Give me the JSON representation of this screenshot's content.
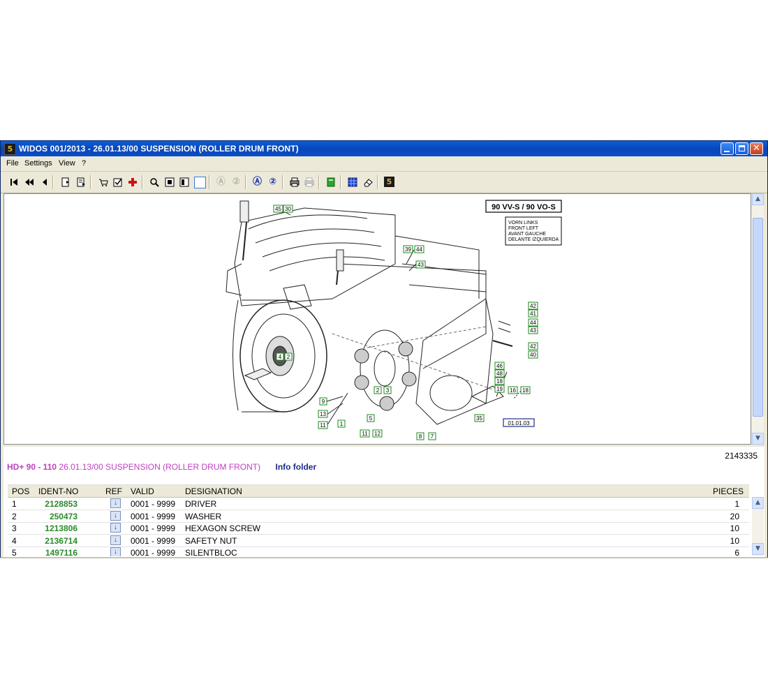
{
  "window": {
    "title": "WIDOS 001/2013 - 26.01.13/00 SUSPENSION (ROLLER DRUM FRONT)",
    "app_icon_glyph": "5"
  },
  "menu": [
    "File",
    "Settings",
    "View",
    "?"
  ],
  "toolbar": [
    {
      "name": "first-page-icon",
      "glyph": "⏮"
    },
    {
      "name": "previous-many-icon",
      "glyph": "⏪"
    },
    {
      "name": "previous-icon",
      "glyph": "◀"
    },
    {
      "name": "document-back-icon",
      "glyph": "🗎"
    },
    {
      "name": "document-forward-icon",
      "glyph": "🗐"
    },
    {
      "name": "cart-icon",
      "glyph": "🛒"
    },
    {
      "name": "checklist-icon",
      "glyph": "☑"
    },
    {
      "name": "add-red-cross-icon",
      "glyph": "✚"
    },
    {
      "name": "zoom-icon",
      "glyph": "🔍"
    },
    {
      "name": "fit-page-icon",
      "glyph": "▣"
    },
    {
      "name": "fit-width-icon",
      "glyph": "◨"
    },
    {
      "name": "select-area-icon",
      "glyph": "□"
    },
    {
      "name": "search-a-disabled-icon",
      "glyph": "Ⓐ"
    },
    {
      "name": "search-2-disabled-icon",
      "glyph": "②"
    },
    {
      "name": "search-a-icon",
      "glyph": "Ⓐ"
    },
    {
      "name": "search-2-icon",
      "glyph": "②"
    },
    {
      "name": "print-icon",
      "glyph": "🖶"
    },
    {
      "name": "print-disabled-icon",
      "glyph": "🖶"
    },
    {
      "name": "green-book-icon",
      "glyph": "📗"
    },
    {
      "name": "grid-icon",
      "glyph": "▦"
    },
    {
      "name": "eraser-icon",
      "glyph": "⌫"
    },
    {
      "name": "widos-logo-icon",
      "glyph": "5"
    }
  ],
  "drawing": {
    "model_box": "90 VV-S / 90 VO-S",
    "orientation_lines": [
      "VORN LINKS",
      "FRONT LEFT",
      "AVANT GAUCHE",
      "DELANTE IZQUIERDA"
    ],
    "reference": "01.01.03",
    "callouts": [
      "45",
      "30",
      "39",
      "44",
      "43",
      "42",
      "41",
      "44",
      "43",
      "42",
      "40",
      "46",
      "48",
      "18",
      "19",
      "16",
      "18",
      "4",
      "2",
      "9",
      "13",
      "11",
      "1",
      "2",
      "3",
      "5",
      "11",
      "12",
      "8",
      "7",
      "35"
    ]
  },
  "info": {
    "doc_number": "2143335",
    "model": "HD+ 90 - 110",
    "description": "26.01.13/00 SUSPENSION (ROLLER DRUM FRONT)",
    "info_folder": "Info folder"
  },
  "table": {
    "headers": {
      "pos": "POS",
      "ident": "IDENT-NO",
      "ref": "REF",
      "valid": "VALID",
      "designation": "DESIGNATION",
      "pieces": "PIECES"
    },
    "rows": [
      {
        "pos": "1",
        "ident": "2128853",
        "ref": "↓",
        "valid": "0001 - 9999",
        "designation": "DRIVER",
        "pieces": "1"
      },
      {
        "pos": "2",
        "ident": "250473",
        "ref": "↓",
        "valid": "0001 - 9999",
        "designation": "WASHER",
        "pieces": "20"
      },
      {
        "pos": "3",
        "ident": "1213806",
        "ref": "↓",
        "valid": "0001 - 9999",
        "designation": "HEXAGON SCREW",
        "pieces": "10"
      },
      {
        "pos": "4",
        "ident": "2136714",
        "ref": "↓",
        "valid": "0001 - 9999",
        "designation": "SAFETY NUT",
        "pieces": "10"
      },
      {
        "pos": "5",
        "ident": "1497116",
        "ref": "↓",
        "valid": "0001 - 9999",
        "designation": "SILENTBLOC",
        "pieces": "6"
      }
    ]
  },
  "colors": {
    "title_bar": "#0a4dc7",
    "model_text": "#c040c0",
    "ident_text": "#2a8a2a",
    "info_folder": "#1e2a8c"
  }
}
